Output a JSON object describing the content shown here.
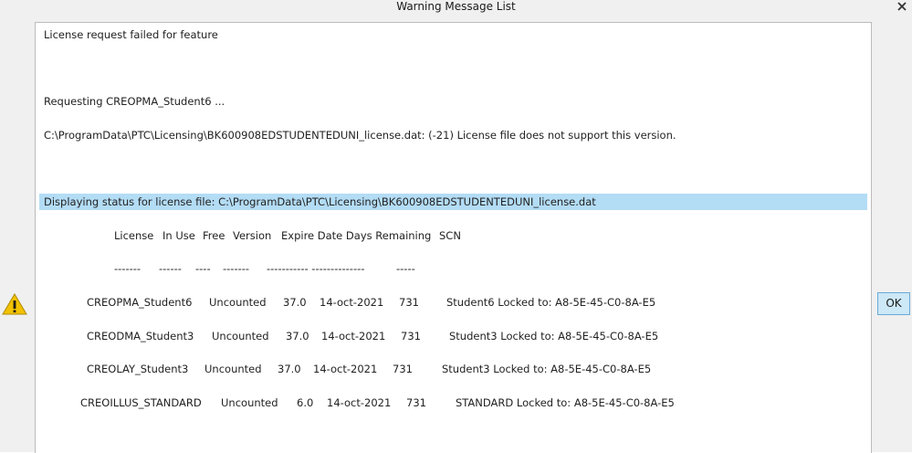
{
  "window": {
    "title": "Warning Message List",
    "ok_label": "OK"
  },
  "messages": {
    "line1": "License request failed for feature",
    "line2": "Requesting CREOPMA_Student6 ...",
    "line3": "C:\\ProgramData\\PTC\\Licensing\\BK600908EDSTUDENTEDUNI_license.dat: (-21) License file does not support this version.",
    "status_line": "Displaying status for license file: C:\\ProgramData\\PTC\\Licensing\\BK600908EDSTUDENTEDUNI_license.dat"
  },
  "table": {
    "headers": {
      "license": "License",
      "in_use": "In Use",
      "free": "Free",
      "version": "Version",
      "expire_days": "Expire Date Days Remaining",
      "scn": "SCN"
    },
    "separators": {
      "license": "-------",
      "in_use": "------",
      "free": "----",
      "version": "-------",
      "expire_days": "----------- --------------",
      "scn": "-----"
    },
    "rows": [
      {
        "name": "CREOPMA_Student6",
        "in_use": "Uncounted",
        "version": "37.0",
        "expire": "14-oct-2021",
        "days": "731",
        "scn": "Student6 Locked to: A8-5E-45-C0-8A-E5"
      },
      {
        "name": "CREODMA_Student3",
        "in_use": "Uncounted",
        "version": "37.0",
        "expire": "14-oct-2021",
        "days": "731",
        "scn": "Student3 Locked to: A8-5E-45-C0-8A-E5"
      },
      {
        "name": "CREOLAY_Student3",
        "in_use": "Uncounted",
        "version": "37.0",
        "expire": "14-oct-2021",
        "days": "731",
        "scn": "Student3 Locked to: A8-5E-45-C0-8A-E5"
      },
      {
        "name": "CREOILLUS_STANDARD",
        "in_use": "Uncounted",
        "version": "6.0",
        "expire": "14-oct-2021",
        "days": "731",
        "scn": "STANDARD Locked to: A8-5E-45-C0-8A-E5"
      }
    ]
  },
  "icons": {
    "close": "close-icon",
    "warning": "warning-icon"
  },
  "colors": {
    "highlight": "#b3dcf5",
    "ok_button_bg": "#cde8f7",
    "ok_button_border": "#6aa9d6",
    "warning_yellow": "#f2c200"
  }
}
